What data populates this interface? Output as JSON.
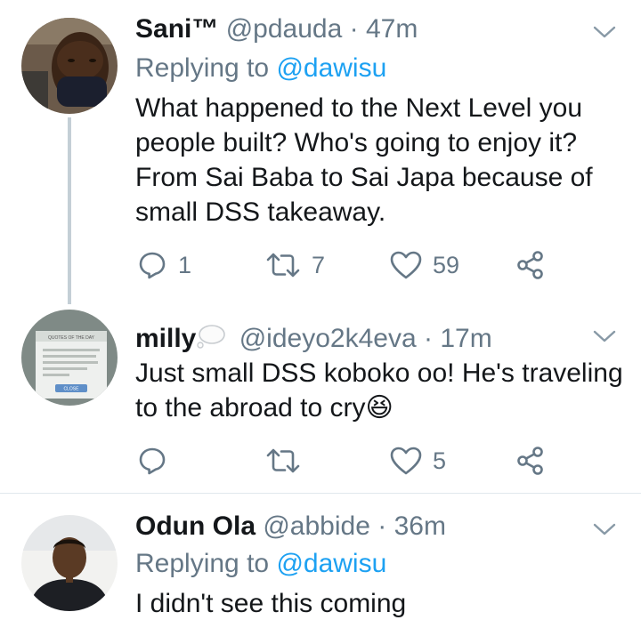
{
  "tweets": [
    {
      "display_name": "Sani™",
      "handle": "@pdauda",
      "time": "47m",
      "replying_prefix": "Replying to",
      "replying_handle": "@dawisu",
      "text": "What happened to the Next Level you people built? Who's going to enjoy it? From Sai Baba to Sai Japa because of small DSS takeaway.",
      "reply_count": "1",
      "retweet_count": "7",
      "like_count": "59"
    },
    {
      "display_name": "milly",
      "handle": "@ideyo2k4eva",
      "time": "17m",
      "text": "Just small DSS koboko oo! He's traveling to the abroad to cry",
      "emoji": "😆",
      "reply_count": "",
      "retweet_count": "",
      "like_count": "5",
      "avatar_image_text": {
        "quote_title": "QUOTES OF THE DAY",
        "quote": "\"We delight in the beauty of the butterfly but rarely admit the changes it has gone through to achieve that beauty\"",
        "author": "Maya Angelou",
        "close": "CLOSE"
      }
    },
    {
      "display_name": "Odun Ola",
      "handle": "@abbide",
      "time": "36m",
      "replying_prefix": "Replying to",
      "replying_handle": "@dawisu",
      "text": "I didn't see this coming"
    }
  ],
  "separator": "·",
  "icons": [
    "reply-icon",
    "retweet-icon",
    "like-icon",
    "share-icon",
    "chevron-down-icon"
  ],
  "colors": {
    "link": "#1da1f2",
    "meta": "#657786",
    "text": "#14171a",
    "thread_line": "#c4cfd6"
  }
}
